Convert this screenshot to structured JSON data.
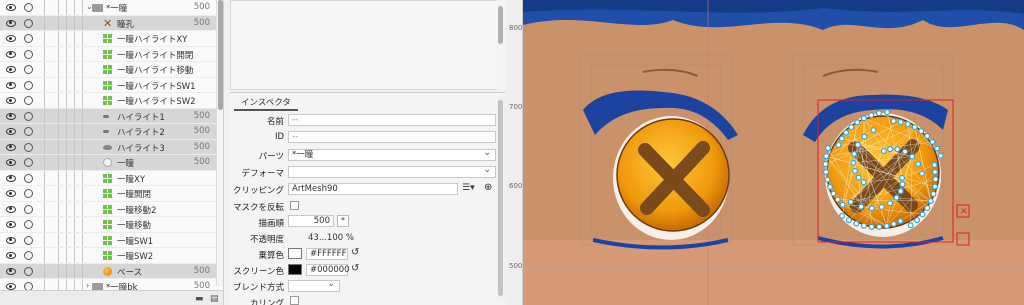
{
  "layers": [
    {
      "name": "*一瞳",
      "value": "500",
      "icon": "folder",
      "indent": 90,
      "expanded": true,
      "selected": false
    },
    {
      "name": "瞳孔",
      "value": "500",
      "icon": "x",
      "indent": 101,
      "selected": true
    },
    {
      "name": "一瞳ハイライトXY",
      "value": "",
      "icon": "grid",
      "indent": 101,
      "selected": false
    },
    {
      "name": "一瞳ハイライト開閉",
      "value": "",
      "icon": "grid",
      "indent": 101,
      "selected": false
    },
    {
      "name": "一瞳ハイライト移動",
      "value": "",
      "icon": "grid",
      "indent": 101,
      "selected": false
    },
    {
      "name": "一瞳ハイライトSW1",
      "value": "",
      "icon": "grid",
      "indent": 101,
      "selected": false
    },
    {
      "name": "一瞳ハイライトSW2",
      "value": "",
      "icon": "grid",
      "indent": 101,
      "selected": false
    },
    {
      "name": "ハイライト1",
      "value": "500",
      "icon": "brush",
      "indent": 101,
      "selected": true
    },
    {
      "name": "ハイライト2",
      "value": "500",
      "icon": "brush",
      "indent": 101,
      "selected": true
    },
    {
      "name": "ハイライト3",
      "value": "500",
      "icon": "blob",
      "indent": 101,
      "selected": true
    },
    {
      "name": "一瞳",
      "value": "500",
      "icon": "ring",
      "indent": 101,
      "selected": true
    },
    {
      "name": "一瞳XY",
      "value": "",
      "icon": "grid",
      "indent": 101,
      "selected": false
    },
    {
      "name": "一瞳開閉",
      "value": "",
      "icon": "grid",
      "indent": 101,
      "selected": false
    },
    {
      "name": "一瞳移動2",
      "value": "",
      "icon": "grid",
      "indent": 101,
      "selected": false
    },
    {
      "name": "一瞳移動",
      "value": "",
      "icon": "grid",
      "indent": 101,
      "selected": false
    },
    {
      "name": "一瞳SW1",
      "value": "",
      "icon": "grid",
      "indent": 101,
      "selected": false
    },
    {
      "name": "一瞳SW2",
      "value": "",
      "icon": "grid",
      "indent": 101,
      "selected": false
    },
    {
      "name": "ベース",
      "value": "500",
      "icon": "orange",
      "indent": 101,
      "selected": true
    },
    {
      "name": "*一瞳bk",
      "value": "500",
      "icon": "folder",
      "indent": 90,
      "expanded": false,
      "selected": false
    }
  ],
  "inspector": {
    "tab": "インスペクタ",
    "name_label": "名前",
    "name_value": "--",
    "id_label": "ID",
    "id_value": "--",
    "parts_label": "パーツ",
    "parts_value": "*一瞳",
    "deformer_label": "デフォーマ",
    "deformer_value": "",
    "clipping_label": "クリッピング",
    "clipping_value": "ArtMesh90",
    "mask_label": "マスクを反転",
    "order_label": "描画順",
    "order_value": "500",
    "order_btn": "*",
    "opacity_label": "不透明度",
    "opacity_value": "43...100 %",
    "multiply_label": "乗算色",
    "multiply_value": "#FFFFFF",
    "screen_label": "スクリーン色",
    "screen_value": "#000000",
    "blend_label": "ブレンド方式",
    "blend_value": "",
    "culling_label": "カリング"
  },
  "ruler": {
    "ticks": [
      "800",
      "700",
      "600",
      "500"
    ]
  },
  "colors": {
    "multiply": "#FFFFFF",
    "screen": "#000000",
    "selection": "#d6d6d6",
    "mesh_handle": "#2aa8e0",
    "bbox": "#e02020"
  }
}
